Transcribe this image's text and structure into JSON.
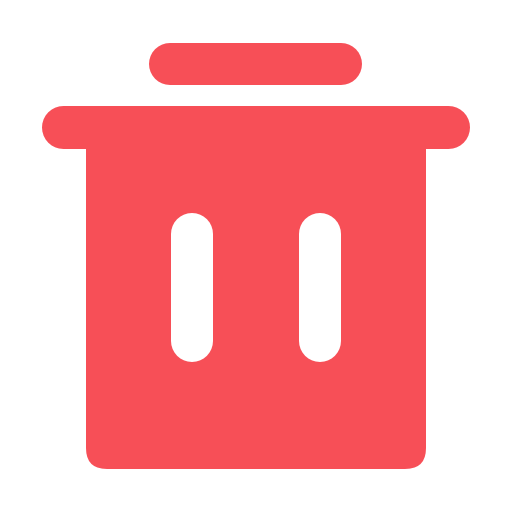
{
  "icon": {
    "name": "trash-can-icon",
    "color": "#F74F57",
    "cutout_color": "#FFFFFF",
    "background": "#FFFFFF"
  }
}
